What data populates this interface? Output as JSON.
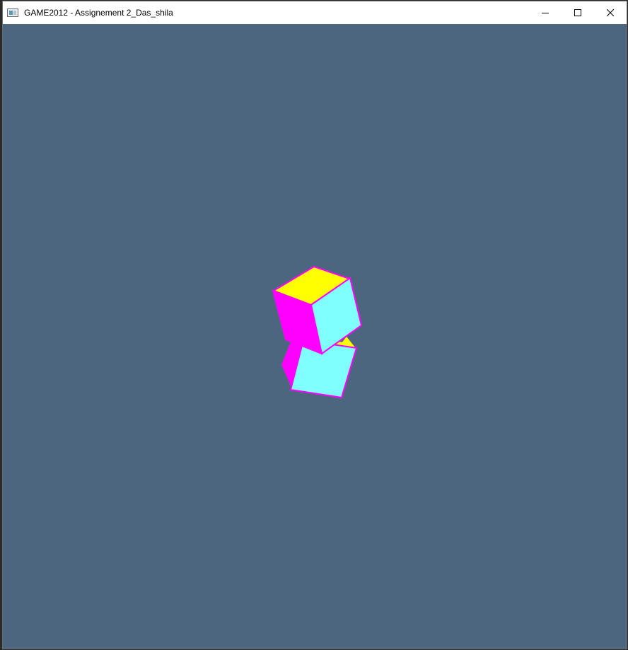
{
  "window": {
    "title": "GAME2012 - Assignement 2_Das_shila",
    "icon": "application-window-icon",
    "controls": [
      "minimize-icon",
      "maximize-icon",
      "close-icon"
    ]
  },
  "viewport": {
    "background": "#4d6680"
  },
  "scene": {
    "objects": [
      {
        "name": "upper-cube",
        "faces": {
          "top": "#ffff00",
          "front": "#80ffff",
          "side": "#ff00ff"
        }
      },
      {
        "name": "lower-cube",
        "faces": {
          "top": "#ffff00",
          "front": "#80ffff",
          "side": "#ff00ff"
        }
      }
    ],
    "edge_color": "#ff00ff"
  }
}
